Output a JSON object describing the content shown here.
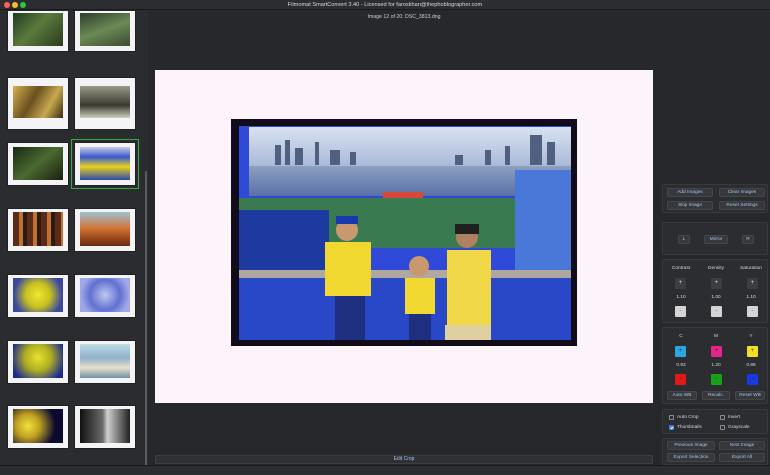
{
  "window": {
    "title": "Filmomat SmartConvert 3.40 - Licensed for faroskhan@thephoblographer.com",
    "close_color": "#ff5f57",
    "minimize_color": "#febc2e",
    "zoom_color": "#28c840"
  },
  "main": {
    "image_info": "Image 12 of 20: DSC_3813.dng",
    "edit_crop_label": "Edit Crop"
  },
  "thumbnails": {
    "selected_index": 5,
    "items": [
      {
        "name": "thumb-1",
        "tone": "#2f4a2a"
      },
      {
        "name": "thumb-2",
        "tone": "#3d5a3a"
      },
      {
        "name": "thumb-3",
        "tone": "#a8802f"
      },
      {
        "name": "thumb-4",
        "tone": "#6b6b5e"
      },
      {
        "name": "thumb-5",
        "tone": "#2c3a24"
      },
      {
        "name": "thumb-6",
        "tone": "#3c58b8"
      },
      {
        "name": "thumb-7",
        "tone": "#5a2a1a"
      },
      {
        "name": "thumb-8",
        "tone": "#b85a2a"
      },
      {
        "name": "thumb-9",
        "tone": "#d8d020"
      },
      {
        "name": "thumb-10",
        "tone": "#9090d8"
      },
      {
        "name": "thumb-11",
        "tone": "#c8c820"
      },
      {
        "name": "thumb-12",
        "tone": "#8fc0d8"
      },
      {
        "name": "thumb-13",
        "tone": "#d8c838"
      },
      {
        "name": "thumb-14",
        "tone": "#1a1a1a"
      }
    ]
  },
  "controls": {
    "add_images": "Add Images",
    "clear_images": "Clear Images",
    "skip_image": "Skip Image",
    "reset_settings": "Reset Settings",
    "rotate_left": "L",
    "mirror": "Mirror",
    "rotate_right": "R",
    "contrast_label": "Contrast",
    "density_label": "Density",
    "saturation_label": "Saturation",
    "contrast_value": "1.10",
    "density_value": "1.00",
    "saturation_value": "1.10",
    "plus": "+",
    "minus": "-",
    "c_label": "C",
    "m_label": "M",
    "y_label": "Y",
    "c_value": "0.93",
    "m_value": "1.20",
    "y_value": "0.86",
    "auto_wb": "Auto WB",
    "recalc": "Recalc.",
    "reset_wb": "Reset WB",
    "auto_crop": "Auto Crop",
    "invert": "Invert",
    "thumbnails": "Thumbnails",
    "grayscale": "Grayscale",
    "auto_crop_checked": false,
    "invert_checked": false,
    "thumbnails_checked": true,
    "grayscale_checked": false,
    "previous_image": "Previous Image",
    "next_image": "Next Image",
    "export_selection": "Export Selection",
    "export_all": "Export All"
  },
  "colors": {
    "cyan": "#2aa7e0",
    "magenta": "#e0288c",
    "yellow": "#f0e020",
    "red": "#e01818",
    "green": "#18a018",
    "blue": "#1838e0",
    "accent_text": "#a9c4ec",
    "selection": "#2fae3b"
  }
}
